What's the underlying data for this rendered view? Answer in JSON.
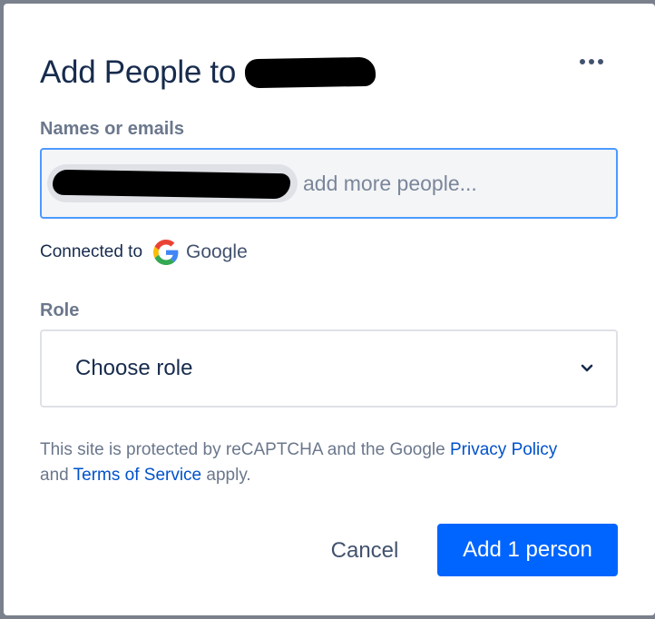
{
  "dialog": {
    "title": "Add People to",
    "more_icon": "more-horizontal-icon"
  },
  "people": {
    "label": "Names or emails",
    "placeholder": "add more people..."
  },
  "connected": {
    "prefix": "Connected to",
    "provider": "Google",
    "provider_icon": "google-g-icon"
  },
  "role": {
    "label": "Role",
    "value": "Choose role",
    "icon": "chevron-down-icon"
  },
  "recaptcha": {
    "text_before": "This site is protected by reCAPTCHA and the Google ",
    "privacy_link": "Privacy Policy",
    "text_middle": " and ",
    "terms_link": "Terms of Service",
    "text_after": " apply."
  },
  "actions": {
    "cancel_label": "Cancel",
    "add_label": "Add 1 person",
    "primary_color": "#0065ff"
  }
}
